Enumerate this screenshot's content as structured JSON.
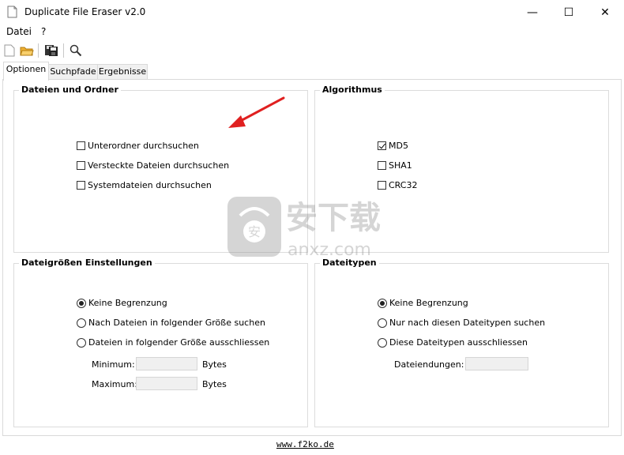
{
  "window": {
    "title": "Duplicate File Eraser v2.0",
    "minimize": "—",
    "maximize": "☐",
    "close": "✕"
  },
  "menu": {
    "items": [
      "Datei",
      "?"
    ]
  },
  "tabs": [
    "Optionen",
    "Suchpfade",
    "Ergebnisse"
  ],
  "groups": {
    "files_folders": {
      "title": "Dateien und Ordner",
      "options": [
        {
          "label": "Unterordner durchsuchen",
          "checked": false
        },
        {
          "label": "Versteckte Dateien durchsuchen",
          "checked": false
        },
        {
          "label": "Systemdateien durchsuchen",
          "checked": false
        }
      ]
    },
    "algorithm": {
      "title": "Algorithmus",
      "options": [
        {
          "label": "MD5",
          "checked": true
        },
        {
          "label": "SHA1",
          "checked": false
        },
        {
          "label": "CRC32",
          "checked": false
        }
      ]
    },
    "file_size": {
      "title": "Dateigrößen Einstellungen",
      "options": [
        {
          "label": "Keine Begrenzung",
          "selected": true
        },
        {
          "label": "Nach Dateien in folgender Größe suchen",
          "selected": false
        },
        {
          "label": "Dateien in folgender Größe ausschliessen",
          "selected": false
        }
      ],
      "min_label": "Minimum:",
      "max_label": "Maximum:",
      "unit": "Bytes"
    },
    "file_types": {
      "title": "Dateitypen",
      "options": [
        {
          "label": "Keine Begrenzung",
          "selected": true
        },
        {
          "label": "Nur nach diesen Dateitypen suchen",
          "selected": false
        },
        {
          "label": "Diese Dateitypen ausschliessen",
          "selected": false
        }
      ],
      "ext_label": "Dateiendungen:"
    }
  },
  "footer": {
    "link": "www.f2ko.de"
  },
  "watermark": {
    "text": "安下载",
    "sub": "anxz.com"
  },
  "colors": {
    "arrow": "#e02020"
  }
}
